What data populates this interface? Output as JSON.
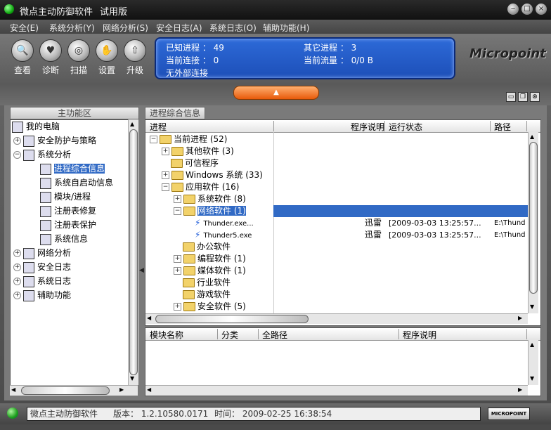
{
  "window": {
    "title": "微点主动防御软件",
    "edition": "试用版"
  },
  "window_buttons": {
    "min": "‒",
    "max": "□",
    "close": "×"
  },
  "menu": [
    "安全(E)",
    "系统分析(Y)",
    "网络分析(S)",
    "安全日志(A)",
    "系统日志(O)",
    "辅助功能(H)"
  ],
  "toolbar": {
    "buttons": [
      {
        "label": "查看",
        "icon": "magnifier-icon"
      },
      {
        "label": "诊断",
        "icon": "heart-icon"
      },
      {
        "label": "扫描",
        "icon": "scan-icon"
      },
      {
        "label": "设置",
        "icon": "hand-icon"
      },
      {
        "label": "升级",
        "icon": "upgrade-icon"
      }
    ]
  },
  "info_panel": {
    "known_processes": "已知进程 ： 49",
    "other_processes": "其它进程 ： 3",
    "current_connections": "当前连接 ： 0",
    "current_traffic": "当前流量 ： 0/0 B",
    "no_external": "无外部连接"
  },
  "logo": "Micropoint",
  "left_panel": {
    "tab": "主功能区",
    "tree": [
      {
        "label": "我的电脑",
        "level": 0,
        "expander": "",
        "selected": false
      },
      {
        "label": "安全防护与策略",
        "level": 1,
        "expander": "+",
        "selected": false
      },
      {
        "label": "系统分析",
        "level": 1,
        "expander": "-",
        "selected": false
      },
      {
        "label": "进程综合信息",
        "level": 2,
        "expander": "",
        "selected": true
      },
      {
        "label": "系统自启动信息",
        "level": 2,
        "expander": "",
        "selected": false
      },
      {
        "label": "模块/进程",
        "level": 2,
        "expander": "",
        "selected": false
      },
      {
        "label": "注册表修复",
        "level": 2,
        "expander": "",
        "selected": false
      },
      {
        "label": "注册表保护",
        "level": 2,
        "expander": "",
        "selected": false
      },
      {
        "label": "系统信息",
        "level": 2,
        "expander": "",
        "selected": false
      },
      {
        "label": "网络分析",
        "level": 1,
        "expander": "+",
        "selected": false
      },
      {
        "label": "安全日志",
        "level": 1,
        "expander": "+",
        "selected": false
      },
      {
        "label": "系统日志",
        "level": 1,
        "expander": "+",
        "selected": false
      },
      {
        "label": "辅助功能",
        "level": 1,
        "expander": "+",
        "selected": false
      }
    ]
  },
  "right_panel": {
    "tab": "进程综合信息",
    "columns": [
      "进程",
      "程序说明",
      "运行状态",
      "路径"
    ],
    "rows": [
      {
        "label": "当前进程 (52)",
        "level": 0,
        "expander": "-",
        "type": "folder",
        "desc": "",
        "status": "",
        "path": "",
        "selected": false
      },
      {
        "label": "其他软件 (3)",
        "level": 1,
        "expander": "+",
        "type": "folder",
        "desc": "",
        "status": "",
        "path": "",
        "selected": false
      },
      {
        "label": "可信程序",
        "level": 1,
        "expander": "",
        "type": "folder",
        "desc": "",
        "status": "",
        "path": "",
        "selected": false
      },
      {
        "label": "Windows 系统 (33)",
        "level": 1,
        "expander": "+",
        "type": "folder",
        "desc": "",
        "status": "",
        "path": "",
        "selected": false
      },
      {
        "label": "应用软件 (16)",
        "level": 1,
        "expander": "-",
        "type": "folder",
        "desc": "",
        "status": "",
        "path": "",
        "selected": false
      },
      {
        "label": "系统软件 (8)",
        "level": 2,
        "expander": "+",
        "type": "folder",
        "desc": "",
        "status": "",
        "path": "",
        "selected": false
      },
      {
        "label": "网络软件 (1)",
        "level": 2,
        "expander": "-",
        "type": "folder",
        "desc": "",
        "status": "",
        "path": "",
        "selected": true
      },
      {
        "label": "Thunder.exe...",
        "level": 3,
        "expander": "",
        "type": "proc",
        "desc": "迅雷",
        "status": "[2009-03-03 13:25:57...",
        "path": "E:\\Thund",
        "selected": false
      },
      {
        "label": "Thunder5.exe",
        "level": 3,
        "expander": "",
        "type": "proc",
        "desc": "迅雷",
        "status": "[2009-03-03 13:25:57...",
        "path": "E:\\Thund",
        "selected": false
      },
      {
        "label": "办公软件",
        "level": 2,
        "expander": "",
        "type": "folder",
        "desc": "",
        "status": "",
        "path": "",
        "selected": false
      },
      {
        "label": "编程软件 (1)",
        "level": 2,
        "expander": "+",
        "type": "folder",
        "desc": "",
        "status": "",
        "path": "",
        "selected": false
      },
      {
        "label": "媒体软件 (1)",
        "level": 2,
        "expander": "+",
        "type": "folder",
        "desc": "",
        "status": "",
        "path": "",
        "selected": false
      },
      {
        "label": "行业软件",
        "level": 2,
        "expander": "",
        "type": "folder",
        "desc": "",
        "status": "",
        "path": "",
        "selected": false
      },
      {
        "label": "游戏软件",
        "level": 2,
        "expander": "",
        "type": "folder",
        "desc": "",
        "status": "",
        "path": "",
        "selected": false
      },
      {
        "label": "安全软件 (5)",
        "level": 2,
        "expander": "+",
        "type": "folder",
        "desc": "",
        "status": "",
        "path": "",
        "selected": false
      }
    ],
    "module_columns": [
      "模块名称",
      "分类",
      "全路径",
      "程序说明"
    ]
  },
  "status_bar": {
    "app": "微点主动防御软件",
    "version": "版本： 1.2.10580.0171",
    "time": "时间： 2009-02-25 16:38:54",
    "badge": "MICROPOINT"
  },
  "colors": {
    "selection": "#316ac5",
    "info_panel": "#2d6ad8",
    "accent_orange": "#e85a0a"
  }
}
